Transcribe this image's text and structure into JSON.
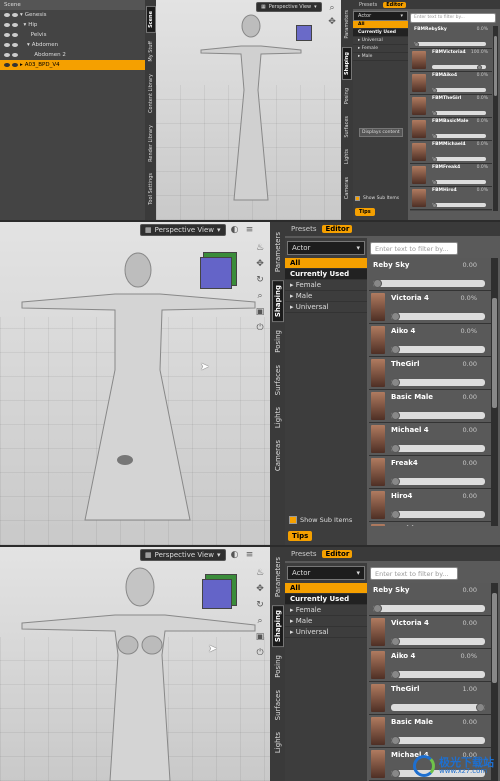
{
  "scene": {
    "header": "Scene",
    "items": [
      "Genesis",
      "Hip",
      "Pelvis",
      "Abdomen",
      "Abdomen 2",
      "A03_BPD_V4"
    ]
  },
  "side_tabs_small": [
    "Scene",
    "My Stuff",
    "Content Library",
    "Render Library",
    "Tool Settings"
  ],
  "view_label": "Perspective View",
  "pane_tabs": [
    "Presets",
    "Editor"
  ],
  "pane_tabs_small": [
    "Presets",
    "Editor"
  ],
  "right_tabs": [
    "Parameters",
    "Shaping",
    "Posing",
    "Surfaces",
    "Lights",
    "Cameras"
  ],
  "right_tabs_small": [
    "Parameters",
    "Shaping",
    "Posing",
    "Surfaces",
    "Lights",
    "Cameras"
  ],
  "actor_dropdown": "Actor",
  "search_placeholder": "Enter text to filter by...",
  "small_search_placeholder": "Enter text to filter by...",
  "categories": [
    "All",
    "Currently Used",
    "▸ Female",
    "▸ Male",
    "▸ Universal"
  ],
  "small_categories": [
    "All",
    "Currently Used",
    "▸ Universal",
    "▸ Female",
    "▸ Male"
  ],
  "small_morphs": [
    {
      "name": "FBMRebySky",
      "value": "0.0%"
    },
    {
      "name": "FBMVictoria4",
      "value": "100.0%"
    },
    {
      "name": "FBMAiko4",
      "value": "0.0%"
    },
    {
      "name": "FBMTheGirl",
      "value": "0.0%"
    },
    {
      "name": "FBMBasicMale",
      "value": "0.0%"
    },
    {
      "name": "FBMMichael4",
      "value": "0.0%"
    },
    {
      "name": "FBMFreak4",
      "value": "0.0%"
    },
    {
      "name": "FBMHiro4",
      "value": "0.0%"
    }
  ],
  "displays_content": "Displays content",
  "show_sub_items": "Show Sub Items",
  "tips": "Tips",
  "morphs_mid": [
    {
      "name": "Reby Sky",
      "value": "0.00",
      "knob": 0.0
    },
    {
      "name": "Victoria 4",
      "value": "0.0%",
      "knob": 0.0
    },
    {
      "name": "Aiko 4",
      "value": "0.0%",
      "knob": 0.0
    },
    {
      "name": "TheGirl",
      "value": "0.00",
      "knob": 0.0
    },
    {
      "name": "Basic Male",
      "value": "0.00",
      "knob": 0.0
    },
    {
      "name": "Michael 4",
      "value": "0.00",
      "knob": 0.0
    },
    {
      "name": "Freak4",
      "value": "0.00",
      "knob": 0.0
    },
    {
      "name": "Hiro4",
      "value": "0.00",
      "knob": 0.0
    },
    {
      "name": "Anubis",
      "value": "",
      "knob": 0.0
    }
  ],
  "morphs_bot": [
    {
      "name": "Reby Sky",
      "value": "0.00",
      "knob": 0.0
    },
    {
      "name": "Victoria 4",
      "value": "0.00",
      "knob": 0.0
    },
    {
      "name": "Aiko 4",
      "value": "0.0%",
      "knob": 0.0
    },
    {
      "name": "TheGirl",
      "value": "1.00",
      "knob": 1.0
    },
    {
      "name": "Basic Male",
      "value": "0.00",
      "knob": 0.0
    },
    {
      "name": "Michael 4",
      "value": "0.00",
      "knob": 0.0
    }
  ],
  "watermark": {
    "site": "极光下载站",
    "url": "www.xz7.com"
  },
  "colors": {
    "accent": "#f5a000"
  }
}
